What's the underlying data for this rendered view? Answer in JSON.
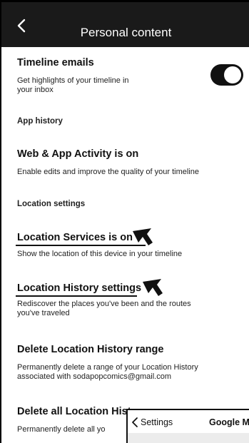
{
  "header": {
    "title": "Personal content"
  },
  "timeline_emails": {
    "title": "Timeline emails",
    "desc_line1": "Get highlights of your timeline in",
    "desc_line2": "your inbox"
  },
  "app_history": {
    "label": "App history"
  },
  "web_app_activity": {
    "title": "Web & App Activity is on",
    "desc": "Enable edits and improve the quality of your timeline"
  },
  "location_settings": {
    "label": "Location settings"
  },
  "location_services": {
    "title": "Location Services is on",
    "desc": "Show the location of this device in your timeline"
  },
  "location_history_settings": {
    "title": "Location History settings",
    "desc_line1": "Rediscover the places you've been and the routes",
    "desc_line2": "you've traveled"
  },
  "delete_range": {
    "title": "Delete Location History range",
    "desc_line1": "Permanently delete a range of your Location History",
    "desc_line2": "associated with sodapopcomics@gmail.com"
  },
  "delete_all": {
    "title": "Delete all Location Hist",
    "desc": "Permanently delete all yo"
  },
  "overlay": {
    "back_label": "Settings",
    "title": "Google M"
  },
  "colors": {
    "header_bg": "#1a1a1a",
    "toggle_on": "#111111",
    "text": "#111111"
  },
  "toggle": {
    "timeline_emails_on": true
  }
}
